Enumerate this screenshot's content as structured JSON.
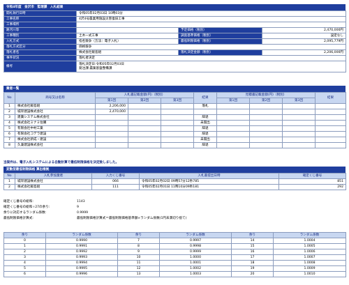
{
  "header_title": "令和4年度　金沢市　監理課　入札結果",
  "overview": {
    "rows": [
      {
        "label": "開札執行日時",
        "value": "令和05年02月03日 10時03分"
      },
      {
        "label": "工事名称",
        "value": "4沢4号農業用施設災害復旧工事"
      },
      {
        "label": "工事場所",
        "value": ""
      }
    ],
    "river_label": "路河川等",
    "river_value": "",
    "planned_price_label": "予定価格（税別）",
    "planned_price_value": "2,470,000円",
    "type_label": "工事種別",
    "type_value": "土木一式工事",
    "survey_label": "調査基準価格（税別）",
    "survey_value": "設定なし",
    "method_label": "入札方式",
    "method_value": "指名競争（方法：電子入札）",
    "min_price_label": "最低制限価格（税別）",
    "min_price_value": "2,095,779円",
    "winner_method_label": "落札方式区分",
    "winner_method_value": "価格競争",
    "winner_label": "落札者名",
    "winner_value": "株式会社飯島組",
    "winner_price_label": "落札決定金額（税別）",
    "winner_price_value": "2,206,000円",
    "status_label": "事件状況",
    "status_value": "落札者決定",
    "remarks_label": "備考",
    "remarks_value1": "落札決定日:令和05年02月03日",
    "remarks_value2": "発注課:農業基盤整備課"
  },
  "bidders": {
    "title": "業者一覧",
    "col_no": "No",
    "col_name": "商号又は名称",
    "col_bid": "入札書記載金額(円)（税別）",
    "col_result": "結果",
    "col_estimate": "見積書記載金額(円)（税別）",
    "col_result2": "結果",
    "round1": "第1回",
    "round2": "第2回",
    "round3": "第3回",
    "rows": [
      {
        "no": "1",
        "name": "株式会社飯島組",
        "r1": "2,206,000",
        "r2": "",
        "r3": "",
        "result": "落札"
      },
      {
        "no": "2",
        "name": "城岸建設株式会社",
        "r1": "2,470,000",
        "r2": "",
        "r3": "",
        "result": ""
      },
      {
        "no": "3",
        "name": "建廣システム株式会社",
        "r1": "",
        "r2": "",
        "r3": "",
        "result": "辞退"
      },
      {
        "no": "4",
        "name": "株式会社ミナミ住購",
        "r1": "",
        "r2": "",
        "r3": "",
        "result": "未開出"
      },
      {
        "no": "5",
        "name": "有限会社中村工業",
        "r1": "",
        "r2": "",
        "r3": "",
        "result": "辞退"
      },
      {
        "no": "6",
        "name": "有限会社コデラ建設",
        "r1": "",
        "r2": "",
        "r3": "",
        "result": "辞退"
      },
      {
        "no": "7",
        "name": "株式会社新成・建設",
        "r1": "",
        "r2": "",
        "r3": "",
        "result": "未開出"
      },
      {
        "no": "8",
        "name": "久兼建設株式会社",
        "r1": "",
        "r2": "",
        "r3": "",
        "result": "辞退"
      }
    ]
  },
  "notice": "当案件は、電子入札システムによる自動計算で最低制限価格を決定致しました。",
  "calc": {
    "title": "変動型最低制限価格 算出根拠",
    "col_no": "No",
    "col_name": "入札参加業者",
    "col_kuji": "入力くじ番号",
    "col_time": "入札書提出日時",
    "col_confirm": "確定くじ番号",
    "rows": [
      {
        "no": "1",
        "name": "城岸建設株式会社",
        "kuji": "066",
        "time": "令和05年02月02日 09時57分12秒785",
        "confirm": "851"
      },
      {
        "no": "2",
        "name": "株式会社飯島組",
        "kuji": "111",
        "time": "令和05年02月01日 11時10分09秒181",
        "confirm": "292"
      }
    ]
  },
  "summary": [
    {
      "label": "確定くじ番号の総和:",
      "value": "1143"
    },
    {
      "label": "確定くじ番号の総和÷27の余り:",
      "value": "9"
    },
    {
      "label": "余りに対応するランダム係数:",
      "value": "0.9999"
    },
    {
      "label": "最低制限価格計算式:",
      "value": "最低制限価格計算式＝最低制限価格基準額×ランダム係数(1円未満切り捨て)"
    }
  ],
  "random": {
    "col_amari": "余り",
    "col_coef": "ランダム係数",
    "rows": [
      [
        "0",
        "0.9990",
        "7",
        "0.9997",
        "14",
        "1.0004"
      ],
      [
        "1",
        "0.9991",
        "8",
        "0.9998",
        "15",
        "1.0005"
      ],
      [
        "2",
        "0.9992",
        "9",
        "0.9999",
        "16",
        "1.0006"
      ],
      [
        "3",
        "0.9993",
        "10",
        "1.0000",
        "17",
        "1.0007"
      ],
      [
        "4",
        "0.9994",
        "11",
        "1.0001",
        "18",
        "1.0008"
      ],
      [
        "5",
        "0.9995",
        "12",
        "1.0002",
        "19",
        "1.0009"
      ],
      [
        "6",
        "0.9996",
        "13",
        "1.0003",
        "20",
        "1.0010"
      ]
    ]
  }
}
